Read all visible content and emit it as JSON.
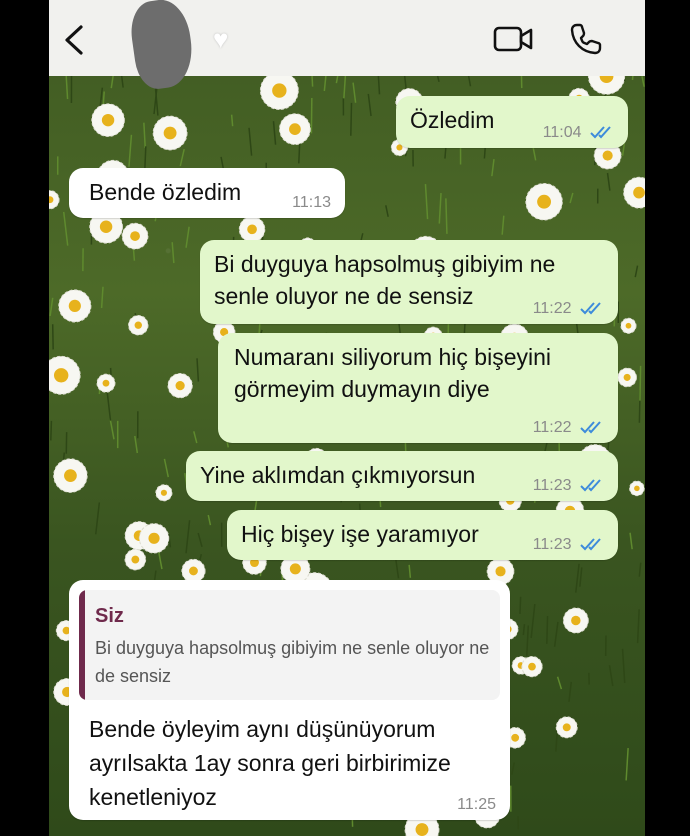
{
  "header": {
    "contact_icon": "heart-icon",
    "video_icon": "video-camera-icon",
    "call_icon": "phone-icon",
    "back_icon": "chevron-left-icon"
  },
  "messages": [
    {
      "direction": "outgoing",
      "text": "Özledim",
      "time": "11:04",
      "status": "read"
    },
    {
      "direction": "incoming",
      "text": "Bende özledim",
      "time": "11:13"
    },
    {
      "direction": "outgoing",
      "text": "Bi duyguya hapsolmuş gibiyim ne senle oluyor ne de sensiz",
      "time": "11:22",
      "status": "read"
    },
    {
      "direction": "outgoing",
      "text": "Numaranı  siliyorum hiç bişeyini görmeyim duymayın diye",
      "time": "11:22",
      "status": "read"
    },
    {
      "direction": "outgoing",
      "text": "Yine aklımdan çıkmıyorsun",
      "time": "11:23",
      "status": "read"
    },
    {
      "direction": "outgoing",
      "text": "Hiç bişey işe yaramıyor",
      "time": "11:23",
      "status": "read"
    },
    {
      "direction": "incoming",
      "reply_to": {
        "author": "Siz",
        "text": "Bi duyguya hapsolmuş gibiyim ne senle oluyor ne de sensiz"
      },
      "text": "Bende öyleyim aynı düşünüyorum ayrılsakta 1ay sonra geri birbirimize kenetleniyoz",
      "time": "11:25"
    }
  ],
  "colors": {
    "outgoing_bubble": "#e2f7cb",
    "incoming_bubble": "#ffffff",
    "read_ticks": "#3d8bdb",
    "quote_accent": "#6f2a4c"
  }
}
